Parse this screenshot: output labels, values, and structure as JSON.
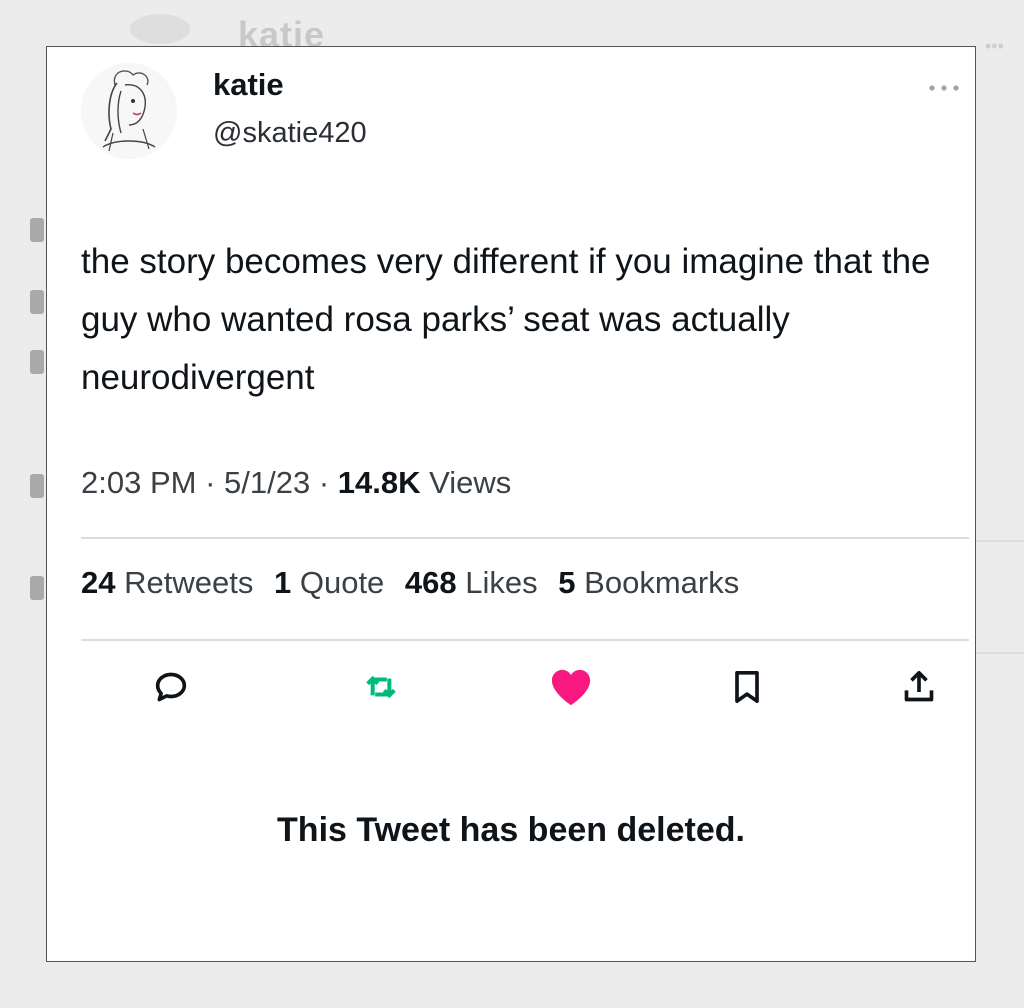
{
  "background": {
    "ghost_name": "katie"
  },
  "tweet": {
    "display_name": "katie",
    "handle": "@skatie420",
    "more_label": "...",
    "text": "the story becomes very different if you imagine that the guy who wanted rosa parks’ seat was actually neurodivergent",
    "time": "2:03 PM",
    "date": "5/1/23",
    "views_count": "14.8K",
    "views_label": "Views",
    "separator": " · "
  },
  "stats": {
    "retweets_count": "24",
    "retweets_label": "Retweets",
    "quotes_count": "1",
    "quotes_label": "Quote",
    "likes_count": "468",
    "likes_label": "Likes",
    "bookmarks_count": "5",
    "bookmarks_label": "Bookmarks"
  },
  "actions": [
    {
      "icon": "reply-icon"
    },
    {
      "icon": "retweet-icon",
      "color": "#00ba7c"
    },
    {
      "icon": "heart-icon",
      "color": "#f91880"
    },
    {
      "icon": "bookmark-icon"
    },
    {
      "icon": "share-icon"
    }
  ],
  "deleted_notice": "This Tweet has been deleted.",
  "colors": {
    "retweet_green": "#00ba7c",
    "like_pink": "#f91880",
    "text": "#0f1419"
  }
}
